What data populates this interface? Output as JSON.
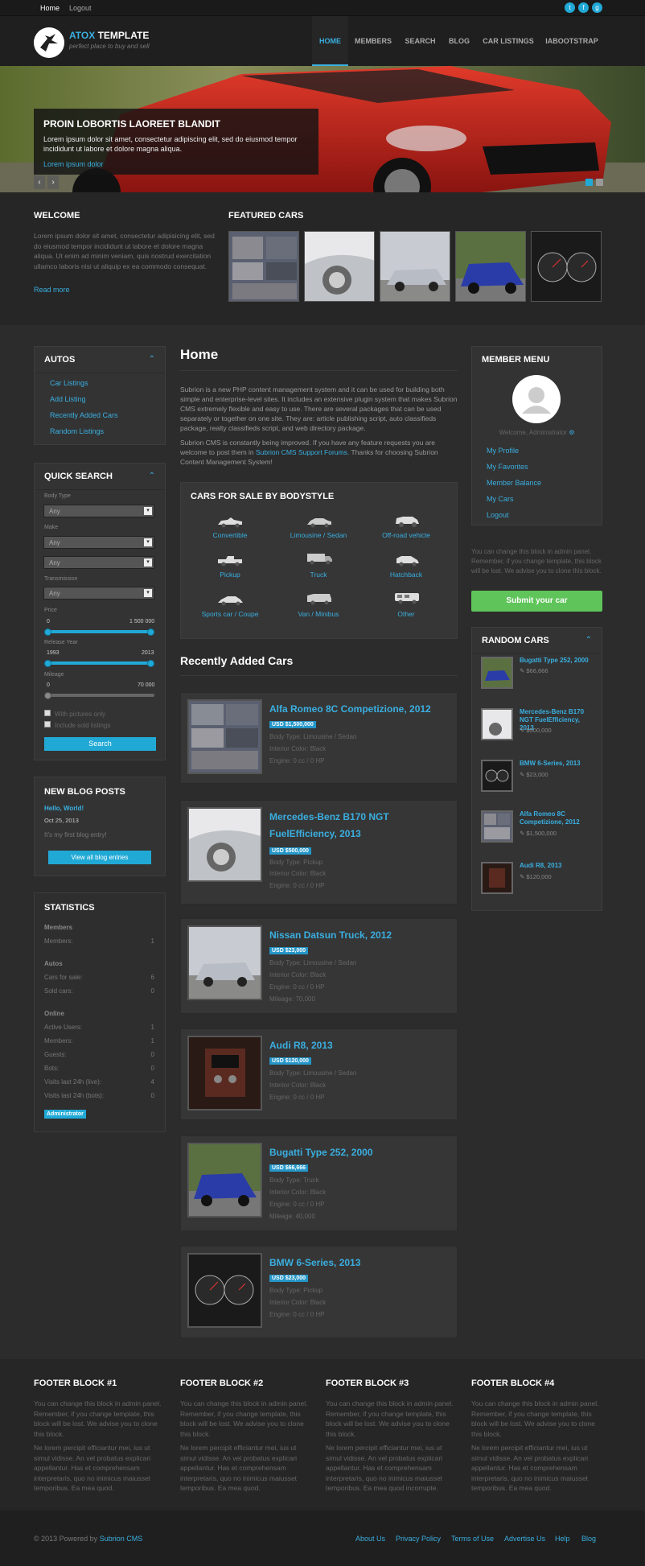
{
  "topbar": {
    "home": "Home",
    "logout": "Logout"
  },
  "logo": {
    "brand": "ATOX",
    "title": " TEMPLATE",
    "tagline": "perfect place to buy and sell"
  },
  "nav": [
    "HOME",
    "MEMBERS",
    "SEARCH",
    "BLOG",
    "CAR LISTINGS",
    "IABOOTSTRAP"
  ],
  "hero": {
    "title": "PROIN LOBORTIS LAOREET BLANDIT",
    "text": "Lorem ipsum dolor sit amet, consectetur adipiscing elit, sed do eiusmod tempor incididunt ut labore et dolore magna aliqua.",
    "link": "Lorem ipsum dolor"
  },
  "welcome": {
    "title": "WELCOME",
    "text": "Lorem ipsum dolor sit amet, consectetur adipisicing elit, sed do eiusmod tempor incididunt ut labore et dolore magna aliqua. Ut enim ad minim veniam, quis nostrud exercitation ullamco laboris nisi ut aliquip ex ea commodo consequat.",
    "more": "Read more"
  },
  "featured": {
    "title": "FEATURED CARS"
  },
  "autos": {
    "title": "AUTOS",
    "links": [
      "Car Listings",
      "Add Listing",
      "Recently Added Cars",
      "Random Listings"
    ]
  },
  "search": {
    "title": "QUICK SEARCH",
    "body_type_label": "Body Type",
    "any": "Any",
    "make_label": "Make",
    "transmission_label": "Transmission",
    "price_label": "Price",
    "price_min": "0",
    "price_max": "1 500 000",
    "year_label": "Release Year",
    "year_min": "1993",
    "year_max": "2013",
    "mileage_label": "Mileage",
    "mileage_min": "0",
    "mileage_max": "70 000",
    "with_pictures": "With pictures only",
    "include_sold": "Include sold listings",
    "button": "Search"
  },
  "blog": {
    "title": "NEW BLOG POSTS",
    "post_title": "Hello, World!",
    "post_date": "Oct 25, 2013",
    "post_text": "It's my first blog entry!",
    "button": "View all blog entries"
  },
  "stats": {
    "title": "STATISTICS",
    "members_h": "Members",
    "members_l": "Members:",
    "members_v": "1",
    "autos_h": "Autos",
    "sale_l": "Cars for sale:",
    "sale_v": "6",
    "sold_l": "Sold cars:",
    "sold_v": "0",
    "online_h": "Online",
    "active_l": "Active Users:",
    "active_v": "1",
    "om_l": "Members:",
    "om_v": "1",
    "guests_l": "Guests:",
    "guests_v": "0",
    "bots_l": "Bots:",
    "bots_v": "0",
    "v24l_l": "Visits last 24h (live):",
    "v24l_v": "4",
    "v24b_l": "Visits last 24h (bots):",
    "v24b_v": "0",
    "admin": "Administrator"
  },
  "home": {
    "title": "Home",
    "p1": "Subrion is a new PHP content management system and it can be used for building both simple and enterprise-level sites. It includes an extensive plugin system that makes Subrion CMS extremely flexible and easy to use. There are several packages that can be used separately or together on one site. They are: article publishing script, auto classifieds package, realty classifieds script, and web directory package.",
    "p2a": "Subrion CMS is constantly being improved. If you have any feature requests you are welcome to post them in ",
    "p2link": "Subrion CMS Support Forums",
    "p2b": ". Thanks for choosing Subrion Content Management System!"
  },
  "bodystyle": {
    "title": "CARS FOR SALE BY BODYSTYLE",
    "items": [
      "Convertible",
      "Limousine / Sedan",
      "Off-road vehicle",
      "Pickup",
      "Truck",
      "Hatchback",
      "Sports car / Coupe",
      "Van / Minibus",
      "Other"
    ]
  },
  "recent": {
    "title": "Recently Added Cars",
    "l_body": "Body Type: ",
    "l_color": "Interior Color: ",
    "l_engine": "Engine: ",
    "l_mileage": "Mileage: ",
    "cars": [
      {
        "title": "Alfa Romeo 8C Competizione, 2012",
        "price": "USD $1,500,000",
        "body": "Limousine / Sedan",
        "color": "Black",
        "engine": "0 cc / 0 HP"
      },
      {
        "title": "Mercedes-Benz B170 NGT FuelEfficiency, 2013",
        "price": "USD $500,000",
        "body": "Pickup",
        "color": "Black",
        "engine": "0 cc / 0 HP"
      },
      {
        "title": "Nissan Datsun Truck, 2012",
        "price": "USD $23,000",
        "body": "Limousine / Sedan",
        "color": "Black",
        "engine": "0 cc / 0 HP",
        "mileage": "70,000"
      },
      {
        "title": "Audi R8, 2013",
        "price": "USD $120,000",
        "body": "Limousine / Sedan",
        "color": "Black",
        "engine": "0 cc / 0 HP"
      },
      {
        "title": "Bugatti Type 252, 2000",
        "price": "USD $66,666",
        "body": "Truck",
        "color": "Black",
        "engine": "0 cc / 0 HP",
        "mileage": "40,000"
      },
      {
        "title": "BMW 6-Series, 2013",
        "price": "USD $23,000",
        "body": "Pickup",
        "color": "Black",
        "engine": "0 cc / 0 HP"
      }
    ]
  },
  "member": {
    "title": "MEMBER MENU",
    "welcome": "Welcome, Administrator",
    "links": [
      "My Profile",
      "My Favorites",
      "Member Balance",
      "My Cars",
      "Logout"
    ],
    "note": "You can change this block in admin panel. Remember, if you change template, this block will be lost. We advise you to clone this block.",
    "submit": "Submit your car"
  },
  "random": {
    "title": "RANDOM CARS",
    "cars": [
      {
        "title": "Bugatti Type 252, 2000",
        "price": "$66,666"
      },
      {
        "title": "Mercedes-Benz B170 NGT FuelEfficiency, 2013",
        "price": "$500,000"
      },
      {
        "title": "BMW 6-Series, 2013",
        "price": "$23,000"
      },
      {
        "title": "Alfa Romeo 8C Competizione, 2012",
        "price": "$1,500,000"
      },
      {
        "title": "Audi R8, 2013",
        "price": "$120,000"
      }
    ]
  },
  "footer": {
    "blocks": [
      {
        "title": "FOOTER BLOCK #1",
        "p1": "You can change this block in admin panel. Remember, if you change template, this block will be lost. We advise you to clone this block.",
        "p2": "Ne lorem percipit efficiantur mei, ius ut simul vidisse. An vel probatus explicari appellantur. Has et comprehensam interpretaris, quo no inimicus maiusset temporibus. Ea mea quod."
      },
      {
        "title": "FOOTER BLOCK #2",
        "p1": "You can change this block in admin panel. Remember, if you change template, this block will be lost. We advise you to clone this block.",
        "p2": "Ne lorem percipit efficiantur mei, ius ut simul vidisse. An vel probatus explicari appellantur. Has et comprehensam interpretaris, quo no inimicus maiusset temporibus. Ea mea quod."
      },
      {
        "title": "FOOTER BLOCK #3",
        "p1": "You can change this block in admin panel. Remember, if you change template, this block will be lost. We advise you to clone this block.",
        "p2": "Ne lorem percipit efficiantur mei, ius ut simul vidisse. An vel probatus explicari appellantur. Has et comprehensam interpretaris, quo no inimicus maiusset temporibus. Ea mea quod incorrupte."
      },
      {
        "title": "FOOTER BLOCK #4",
        "p1": "You can change this block in admin panel. Remember, if you change template, this block will be lost. We advise you to clone this block.",
        "p2": "Ne lorem percipit efficiantur mei, ius ut simul vidisse. An vel probatus explicari appellantur. Has et comprehensam interpretaris, quo no inimicus maiusset temporibus. Ea mea quod."
      }
    ]
  },
  "bottom": {
    "copy": "© 2013 Powered by ",
    "cms": "Subrion CMS",
    "links": [
      "About Us",
      "Privacy Policy",
      "Terms of Use",
      "Advertise Us",
      "Help",
      "Blog"
    ]
  }
}
